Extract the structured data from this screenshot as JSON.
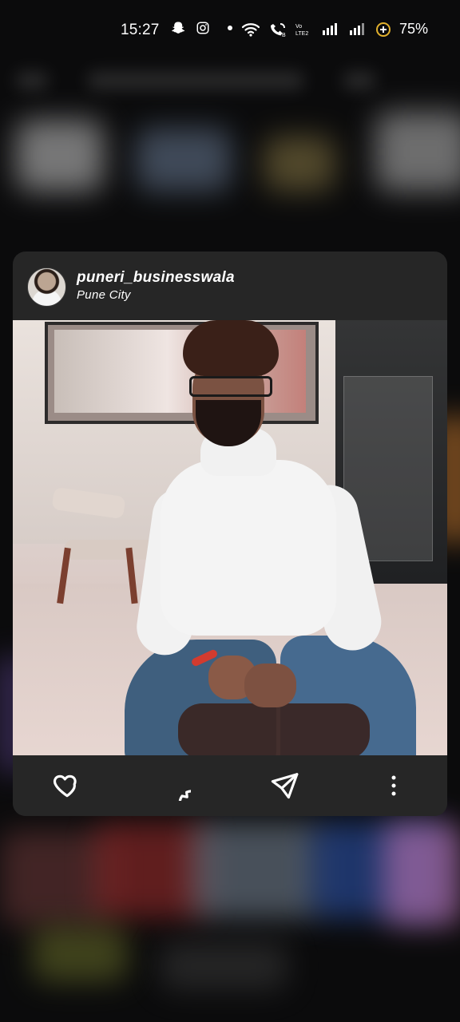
{
  "status_bar": {
    "time": "15:27",
    "battery_percent": "75%",
    "icons": [
      "snapchat-icon",
      "instagram-icon",
      "dot-icon",
      "wifi-icon",
      "wifi-calling-icon",
      "volte-icon",
      "signal-icon",
      "signal-icon",
      "battery-saver-icon"
    ]
  },
  "post_preview": {
    "username": "puneri_businesswala",
    "location": "Pune City",
    "actions": {
      "like_icon": "heart-icon",
      "comment_icon": "comment-icon",
      "share_icon": "send-icon",
      "more_icon": "more-vertical-icon"
    }
  }
}
